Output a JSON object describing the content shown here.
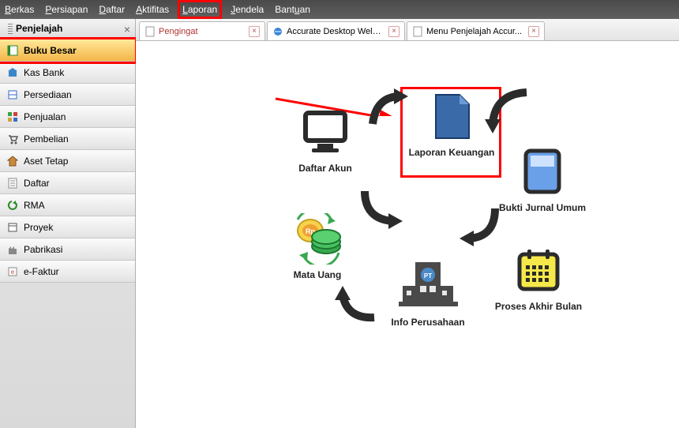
{
  "menubar": {
    "items": [
      {
        "label": "Berkas",
        "ul": "B"
      },
      {
        "label": "Persiapan",
        "ul": "P"
      },
      {
        "label": "Daftar",
        "ul": "D"
      },
      {
        "label": "Aktifitas",
        "ul": "A"
      },
      {
        "label": "Laporan",
        "ul": "L",
        "highlight": true
      },
      {
        "label": "Jendela",
        "ul": "J"
      },
      {
        "label": "Bantuan",
        "ul": "B"
      }
    ]
  },
  "sidebar": {
    "title": "Penjelajah",
    "items": [
      {
        "label": "Buku Besar",
        "icon": "book-icon",
        "selected": true,
        "highlight": true
      },
      {
        "label": "Kas Bank",
        "icon": "bank-icon"
      },
      {
        "label": "Persediaan",
        "icon": "inventory-icon"
      },
      {
        "label": "Penjualan",
        "icon": "sales-icon"
      },
      {
        "label": "Pembelian",
        "icon": "cart-icon"
      },
      {
        "label": "Aset Tetap",
        "icon": "asset-icon"
      },
      {
        "label": "Daftar",
        "icon": "list-icon"
      },
      {
        "label": "RMA",
        "icon": "rma-icon"
      },
      {
        "label": "Proyek",
        "icon": "project-icon"
      },
      {
        "label": "Pabrikasi",
        "icon": "factory-icon"
      },
      {
        "label": "e-Faktur",
        "icon": "efaktur-icon"
      }
    ]
  },
  "tabs": [
    {
      "label": "Pengingat",
      "icon": "doc-icon",
      "kind": "pengingat"
    },
    {
      "label": "Accurate Desktop Welcome...",
      "icon": "ie-icon",
      "kind": "web"
    },
    {
      "label": "Menu Penjelajah Accur...",
      "icon": "doc-icon",
      "kind": "doc"
    }
  ],
  "flow": {
    "daftar_akun": "Daftar Akun",
    "laporan_keuangan": "Laporan Keuangan",
    "bukti_jurnal": "Bukti Jurnal Umum",
    "mata_uang": "Mata Uang",
    "info_perusahaan": "Info Perusahaan",
    "proses_akhir": "Proses Akhir Bulan"
  }
}
